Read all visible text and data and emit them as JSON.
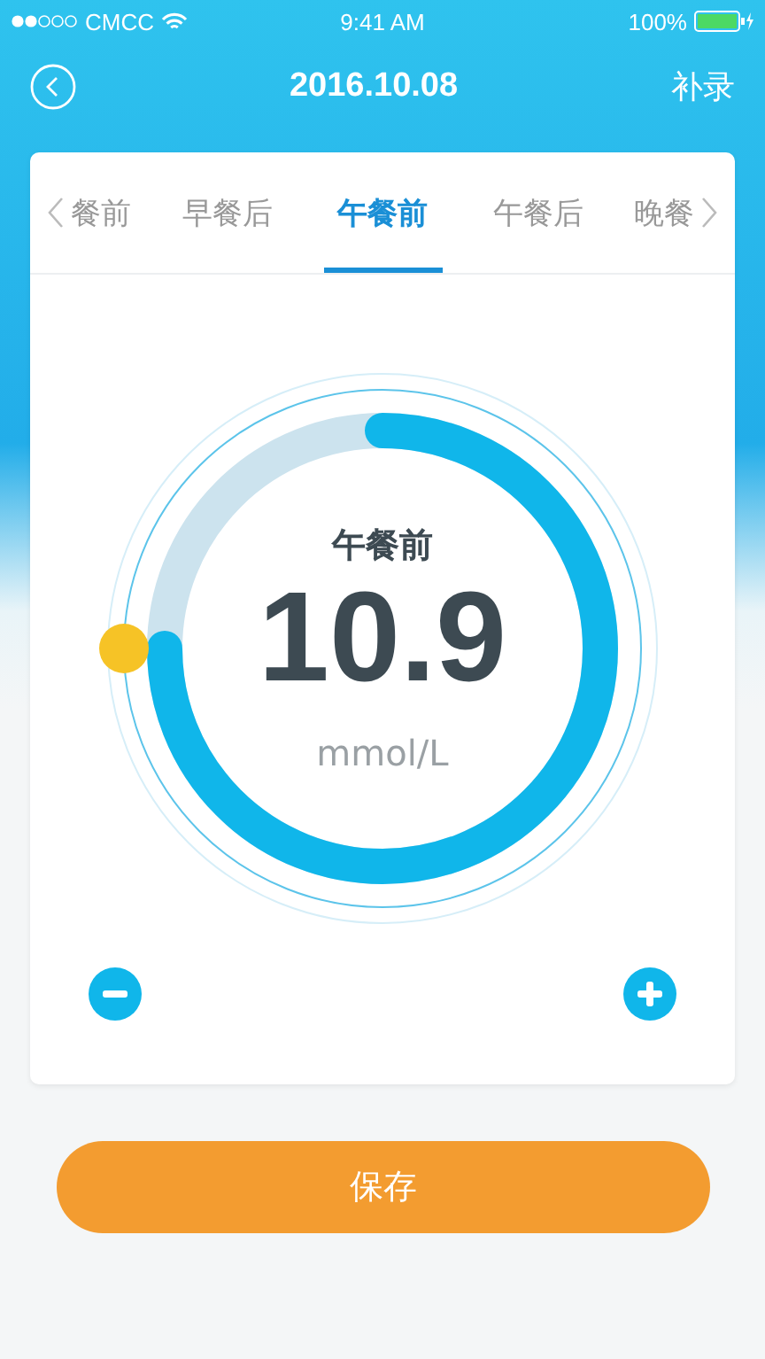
{
  "status_bar": {
    "carrier": "CMCC",
    "time": "9:41 AM",
    "battery": "100%"
  },
  "nav": {
    "title": "2016.10.08",
    "action": "补录"
  },
  "tabs": [
    {
      "label": "餐前",
      "selected": false
    },
    {
      "label": "早餐后",
      "selected": false
    },
    {
      "label": "午餐前",
      "selected": true
    },
    {
      "label": "午餐后",
      "selected": false
    },
    {
      "label": "晚餐",
      "selected": false
    }
  ],
  "dial": {
    "label": "午餐前",
    "value": "10.9",
    "unit": "mmol/L"
  },
  "save_button": "保存"
}
